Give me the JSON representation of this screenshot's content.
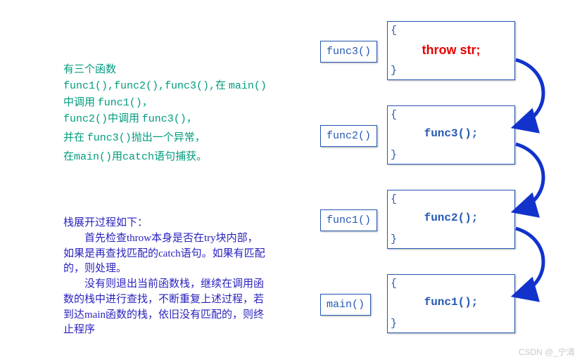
{
  "intro": {
    "line1": "有三个函数",
    "line2a": "func1(),func2(),func3(),",
    "line2b": "在 ",
    "line2c": "main()",
    "line2d": " 中调用 ",
    "line2e": "func1()",
    "line2f": "，",
    "line3a": "func2()",
    "line3b": "中调用 ",
    "line3c": "func3()",
    "line3d": "，",
    "line4a": "并在 ",
    "line4b": "func3()",
    "line4c": "抛出一个异常，",
    "line5a": "在",
    "line5b": "main()",
    "line5c": "用",
    "line5d": "catch",
    "line5e": "语句捕获。"
  },
  "process": {
    "title": "栈展开过程如下：",
    "p1": "　　首先检查throw本身是否在try块内部，如果是再查找匹配的catch语句。如果有匹配的，则处理。",
    "p2": "　　没有则退出当前函数栈，继续在调用函数的栈中进行查找，不断重复上述过程，若到达main函数的栈，依旧没有匹配的，则终止程序"
  },
  "stack": [
    {
      "label": "func3()",
      "body": "throw str;",
      "throw": true
    },
    {
      "label": "func2()",
      "body": "func3();"
    },
    {
      "label": "func1()",
      "body": "func2();"
    },
    {
      "label": "main()",
      "body": "func1();"
    }
  ],
  "watermark": "CSDN @_宁清"
}
